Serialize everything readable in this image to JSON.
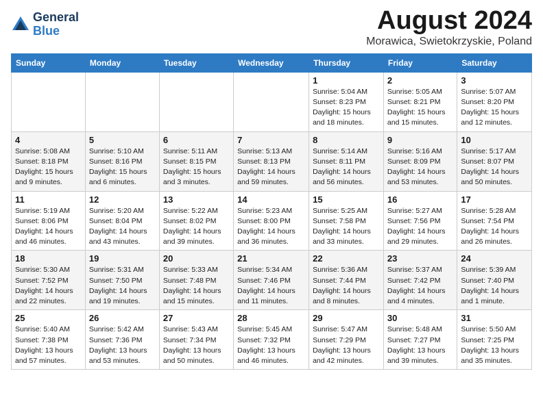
{
  "header": {
    "logo_general": "General",
    "logo_blue": "Blue",
    "main_title": "August 2024",
    "subtitle": "Morawica, Swietokrzyskie, Poland"
  },
  "weekdays": [
    "Sunday",
    "Monday",
    "Tuesday",
    "Wednesday",
    "Thursday",
    "Friday",
    "Saturday"
  ],
  "weeks": [
    [
      {
        "day": "",
        "info": ""
      },
      {
        "day": "",
        "info": ""
      },
      {
        "day": "",
        "info": ""
      },
      {
        "day": "",
        "info": ""
      },
      {
        "day": "1",
        "info": "Sunrise: 5:04 AM\nSunset: 8:23 PM\nDaylight: 15 hours\nand 18 minutes."
      },
      {
        "day": "2",
        "info": "Sunrise: 5:05 AM\nSunset: 8:21 PM\nDaylight: 15 hours\nand 15 minutes."
      },
      {
        "day": "3",
        "info": "Sunrise: 5:07 AM\nSunset: 8:20 PM\nDaylight: 15 hours\nand 12 minutes."
      }
    ],
    [
      {
        "day": "4",
        "info": "Sunrise: 5:08 AM\nSunset: 8:18 PM\nDaylight: 15 hours\nand 9 minutes."
      },
      {
        "day": "5",
        "info": "Sunrise: 5:10 AM\nSunset: 8:16 PM\nDaylight: 15 hours\nand 6 minutes."
      },
      {
        "day": "6",
        "info": "Sunrise: 5:11 AM\nSunset: 8:15 PM\nDaylight: 15 hours\nand 3 minutes."
      },
      {
        "day": "7",
        "info": "Sunrise: 5:13 AM\nSunset: 8:13 PM\nDaylight: 14 hours\nand 59 minutes."
      },
      {
        "day": "8",
        "info": "Sunrise: 5:14 AM\nSunset: 8:11 PM\nDaylight: 14 hours\nand 56 minutes."
      },
      {
        "day": "9",
        "info": "Sunrise: 5:16 AM\nSunset: 8:09 PM\nDaylight: 14 hours\nand 53 minutes."
      },
      {
        "day": "10",
        "info": "Sunrise: 5:17 AM\nSunset: 8:07 PM\nDaylight: 14 hours\nand 50 minutes."
      }
    ],
    [
      {
        "day": "11",
        "info": "Sunrise: 5:19 AM\nSunset: 8:06 PM\nDaylight: 14 hours\nand 46 minutes."
      },
      {
        "day": "12",
        "info": "Sunrise: 5:20 AM\nSunset: 8:04 PM\nDaylight: 14 hours\nand 43 minutes."
      },
      {
        "day": "13",
        "info": "Sunrise: 5:22 AM\nSunset: 8:02 PM\nDaylight: 14 hours\nand 39 minutes."
      },
      {
        "day": "14",
        "info": "Sunrise: 5:23 AM\nSunset: 8:00 PM\nDaylight: 14 hours\nand 36 minutes."
      },
      {
        "day": "15",
        "info": "Sunrise: 5:25 AM\nSunset: 7:58 PM\nDaylight: 14 hours\nand 33 minutes."
      },
      {
        "day": "16",
        "info": "Sunrise: 5:27 AM\nSunset: 7:56 PM\nDaylight: 14 hours\nand 29 minutes."
      },
      {
        "day": "17",
        "info": "Sunrise: 5:28 AM\nSunset: 7:54 PM\nDaylight: 14 hours\nand 26 minutes."
      }
    ],
    [
      {
        "day": "18",
        "info": "Sunrise: 5:30 AM\nSunset: 7:52 PM\nDaylight: 14 hours\nand 22 minutes."
      },
      {
        "day": "19",
        "info": "Sunrise: 5:31 AM\nSunset: 7:50 PM\nDaylight: 14 hours\nand 19 minutes."
      },
      {
        "day": "20",
        "info": "Sunrise: 5:33 AM\nSunset: 7:48 PM\nDaylight: 14 hours\nand 15 minutes."
      },
      {
        "day": "21",
        "info": "Sunrise: 5:34 AM\nSunset: 7:46 PM\nDaylight: 14 hours\nand 11 minutes."
      },
      {
        "day": "22",
        "info": "Sunrise: 5:36 AM\nSunset: 7:44 PM\nDaylight: 14 hours\nand 8 minutes."
      },
      {
        "day": "23",
        "info": "Sunrise: 5:37 AM\nSunset: 7:42 PM\nDaylight: 14 hours\nand 4 minutes."
      },
      {
        "day": "24",
        "info": "Sunrise: 5:39 AM\nSunset: 7:40 PM\nDaylight: 14 hours\nand 1 minute."
      }
    ],
    [
      {
        "day": "25",
        "info": "Sunrise: 5:40 AM\nSunset: 7:38 PM\nDaylight: 13 hours\nand 57 minutes."
      },
      {
        "day": "26",
        "info": "Sunrise: 5:42 AM\nSunset: 7:36 PM\nDaylight: 13 hours\nand 53 minutes."
      },
      {
        "day": "27",
        "info": "Sunrise: 5:43 AM\nSunset: 7:34 PM\nDaylight: 13 hours\nand 50 minutes."
      },
      {
        "day": "28",
        "info": "Sunrise: 5:45 AM\nSunset: 7:32 PM\nDaylight: 13 hours\nand 46 minutes."
      },
      {
        "day": "29",
        "info": "Sunrise: 5:47 AM\nSunset: 7:29 PM\nDaylight: 13 hours\nand 42 minutes."
      },
      {
        "day": "30",
        "info": "Sunrise: 5:48 AM\nSunset: 7:27 PM\nDaylight: 13 hours\nand 39 minutes."
      },
      {
        "day": "31",
        "info": "Sunrise: 5:50 AM\nSunset: 7:25 PM\nDaylight: 13 hours\nand 35 minutes."
      }
    ]
  ]
}
